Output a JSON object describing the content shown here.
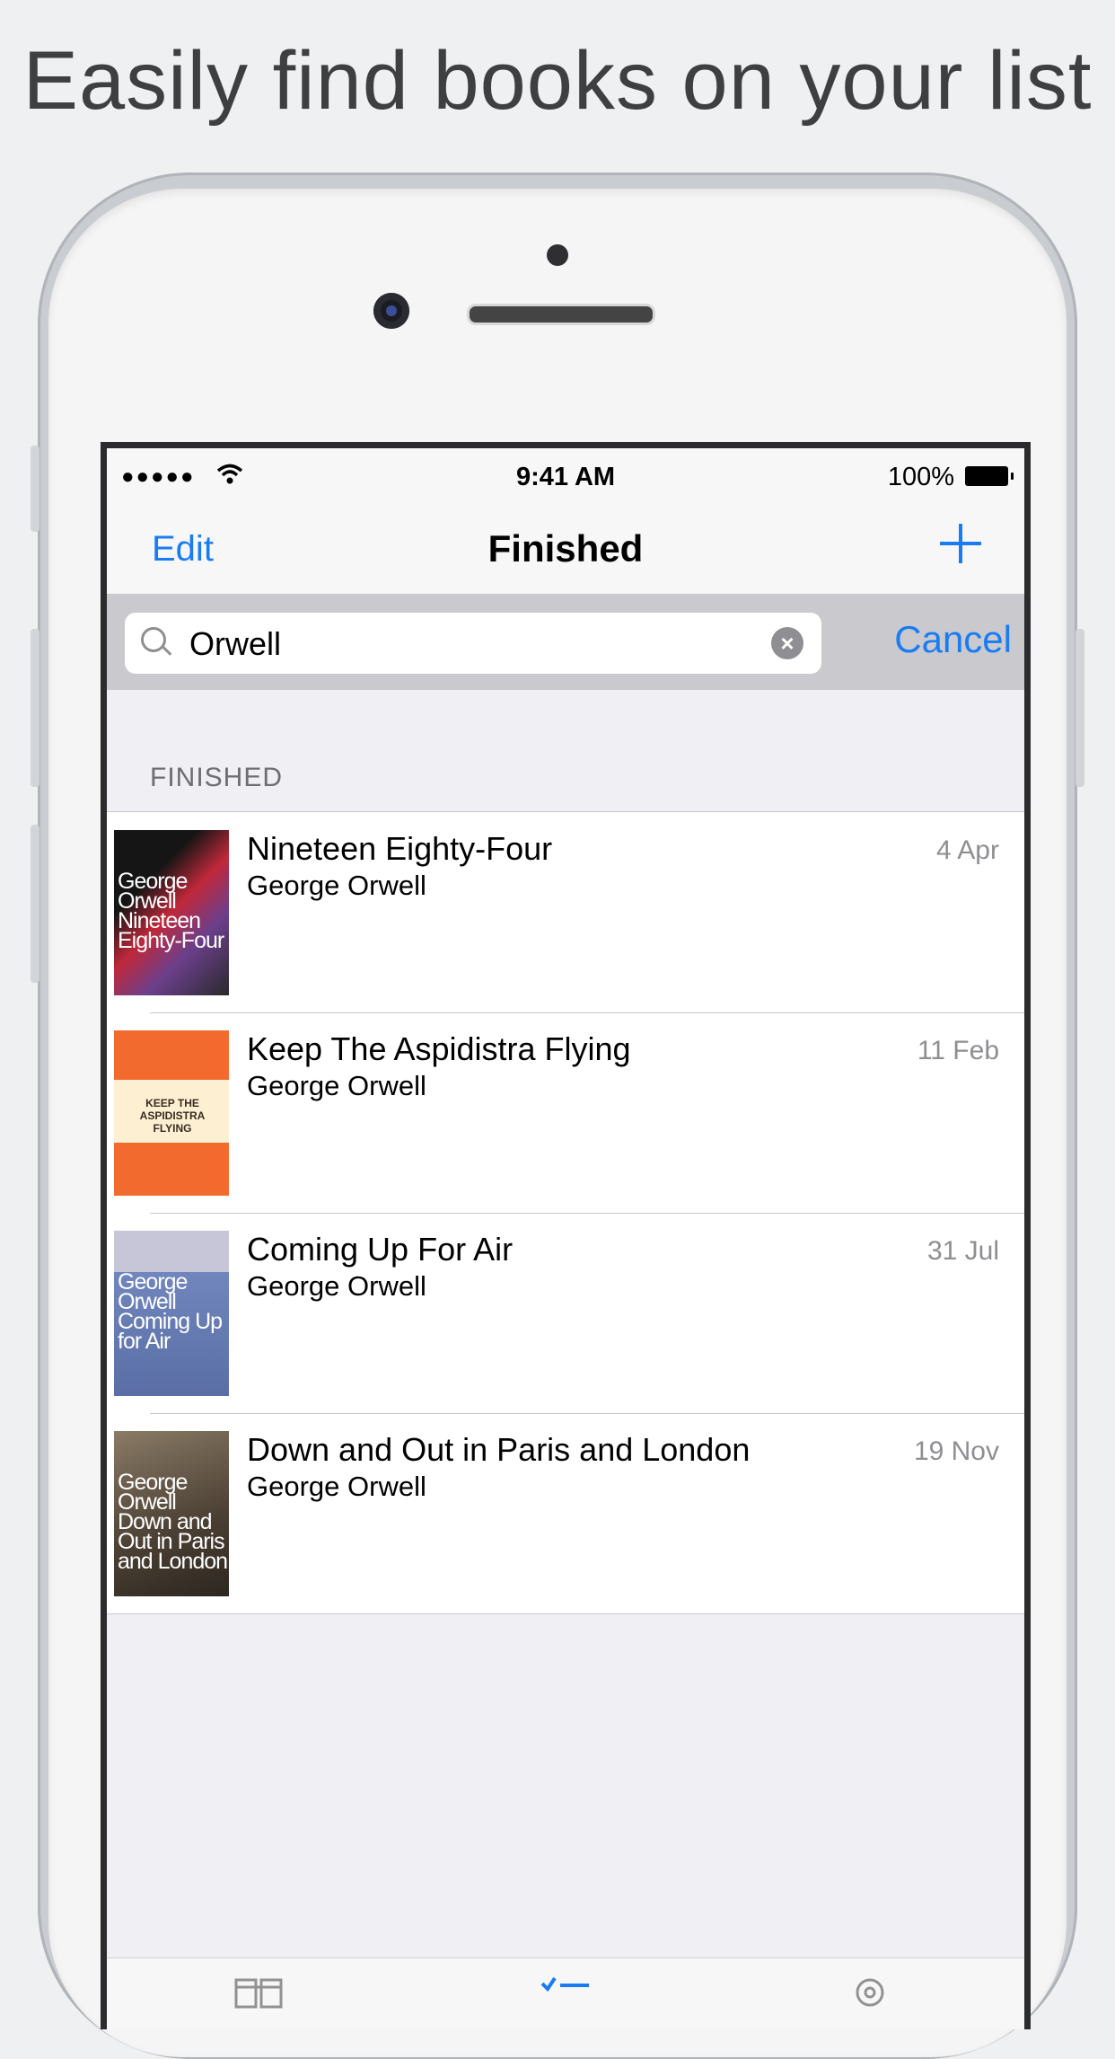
{
  "headline": "Easily find books on your list",
  "status_bar": {
    "signal": "●●●●●",
    "time": "9:41 AM",
    "battery": "100%"
  },
  "nav": {
    "edit": "Edit",
    "title": "Finished",
    "add_icon": "plus-icon"
  },
  "search": {
    "value": "Orwell",
    "cancel": "Cancel"
  },
  "section": {
    "header": "FINISHED"
  },
  "books": [
    {
      "title": "Nineteen Eighty-Four",
      "author": "George Orwell",
      "date": "4 Apr",
      "cover_text": "George Orwell Nineteen Eighty-Four",
      "cover_color": "#1b1b1b"
    },
    {
      "title": "Keep The Aspidistra Flying",
      "author": "George Orwell",
      "date": "11 Feb",
      "cover_text": "KEEP THE ASPIDISTRA FLYING",
      "cover_color": "#f26a2e"
    },
    {
      "title": "Coming Up For Air",
      "author": "George Orwell",
      "date": "31 Jul",
      "cover_text": "George Orwell Coming Up for Air",
      "cover_color": "#6d83b8"
    },
    {
      "title": "Down and Out in Paris and London",
      "author": "George Orwell",
      "date": "19 Nov",
      "cover_text": "George Orwell Down and Out in Paris and London",
      "cover_color": "#5a4e42"
    }
  ],
  "colors": {
    "accent": "#1a7cf5",
    "background": "#efeff4"
  }
}
